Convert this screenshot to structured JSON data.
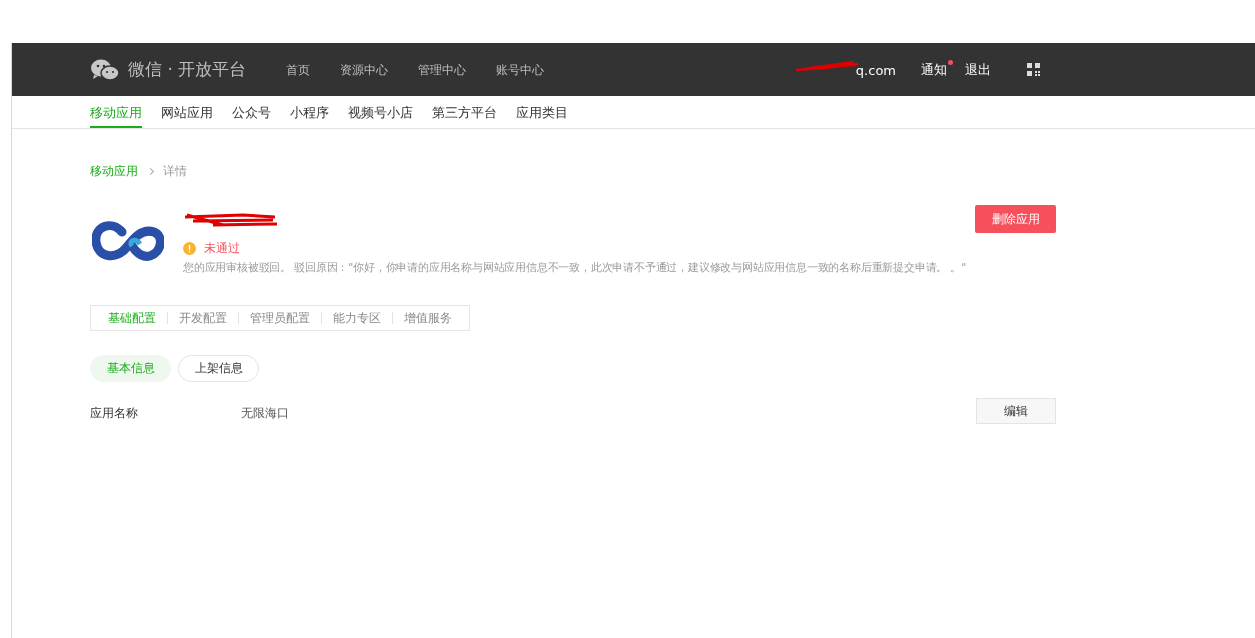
{
  "header": {
    "brand": "微信 · 开放平台",
    "nav": [
      {
        "label": "首页"
      },
      {
        "label": "资源中心"
      },
      {
        "label": "管理中心"
      },
      {
        "label": "账号中心"
      }
    ],
    "account": "q.com",
    "notice": {
      "label": "通知",
      "unread": true
    },
    "logout": "退出"
  },
  "category_tabs": [
    {
      "label": "移动应用",
      "selected": true
    },
    {
      "label": "网站应用",
      "selected": false
    },
    {
      "label": "公众号",
      "selected": false
    },
    {
      "label": "小程序",
      "selected": false
    },
    {
      "label": "视频号小店",
      "selected": false
    },
    {
      "label": "第三方平台",
      "selected": false
    },
    {
      "label": "应用类目",
      "selected": false
    }
  ],
  "breadcrumb": [
    {
      "label": "移动应用"
    },
    {
      "label": "详情"
    }
  ],
  "app": {
    "status": "未通过",
    "message": "您的应用审核被驳回。 驳回原因：\"你好，你申请的应用名称与网站应用信息不一致，此次申请不予通过，建议修改与网站应用信息一致的名称后重新提交申请。 。\"",
    "delete_button": "删除应用"
  },
  "config_tabs": [
    {
      "label": "基础配置",
      "selected": true
    },
    {
      "label": "开发配置",
      "selected": false
    },
    {
      "label": "管理员配置",
      "selected": false
    },
    {
      "label": "能力专区",
      "selected": false
    },
    {
      "label": "增值服务",
      "selected": false
    }
  ],
  "info_tabs": [
    {
      "label": "基本信息",
      "selected": true
    },
    {
      "label": "上架信息",
      "selected": false
    }
  ],
  "row": {
    "label": "应用名称",
    "value": "无限海口",
    "edit_button": "编辑"
  }
}
